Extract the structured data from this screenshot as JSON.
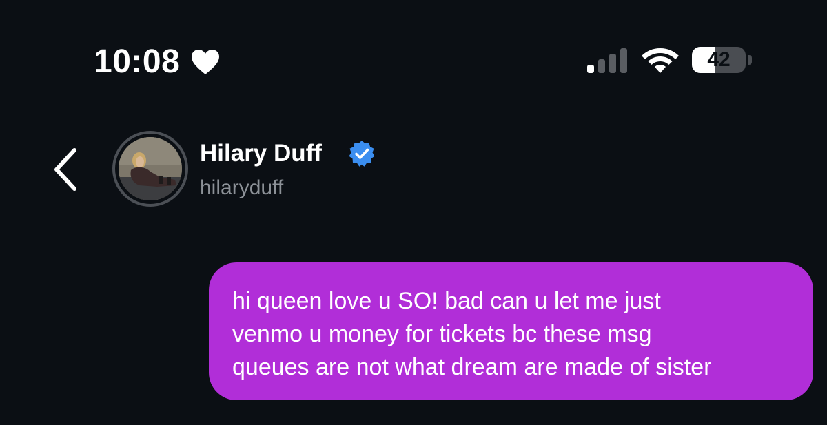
{
  "status_bar": {
    "time": "10:08",
    "status_icon": "heart-icon",
    "signal_icon": "cellular-signal-icon",
    "wifi_icon": "wifi-icon",
    "battery_level": 42,
    "battery_label": "42"
  },
  "header": {
    "back_icon": "chevron-left-icon",
    "display_name": "Hilary Duff",
    "verified_icon": "verified-badge-icon",
    "username": "hilaryduff"
  },
  "messages": [
    {
      "direction": "outgoing",
      "lines": [
        "hi queen love u SO! bad can u let me just",
        "venmo u money for tickets bc these msg",
        "queues are not what dream are made of sister"
      ]
    }
  ],
  "colors": {
    "background": "#0b0f14",
    "outgoing_bubble": "#b12ed8",
    "verified": "#3b8ef0",
    "secondary_text": "#8c9197"
  }
}
